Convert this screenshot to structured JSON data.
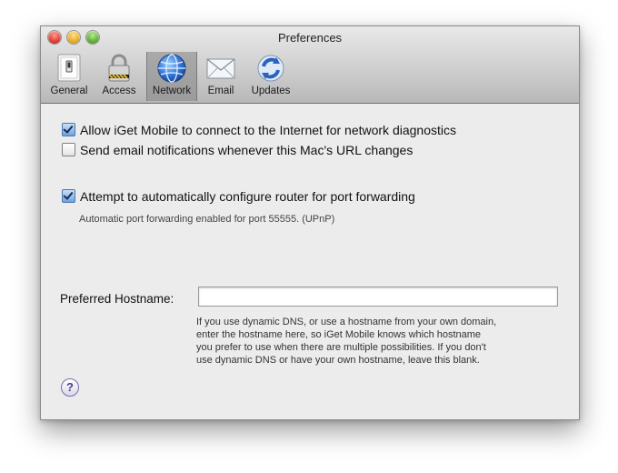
{
  "window": {
    "title": "Preferences"
  },
  "toolbar": {
    "items": [
      {
        "label": "General",
        "icon": "switch-icon"
      },
      {
        "label": "Access",
        "icon": "lock-icon"
      },
      {
        "label": "Network",
        "icon": "globe-icon",
        "selected": true
      },
      {
        "label": "Email",
        "icon": "envelope-icon"
      },
      {
        "label": "Updates",
        "icon": "sync-icon"
      }
    ]
  },
  "options": {
    "allow_connect": {
      "label": "Allow iGet Mobile to connect to the Internet for network diagnostics",
      "checked": true
    },
    "email_notify": {
      "label": "Send email notifications whenever this Mac's URL changes",
      "checked": false
    },
    "auto_router": {
      "label": "Attempt to automatically configure router for port forwarding",
      "checked": true
    },
    "port_status": "Automatic port forwarding enabled for port 55555. (UPnP)"
  },
  "hostname": {
    "label": "Preferred Hostname:",
    "value": "",
    "help": [
      "If you use dynamic DNS, or use a hostname from your own domain,",
      "enter the hostname here, so iGet Mobile knows which hostname",
      "you prefer to use when there are multiple possibilities. If you don't",
      "use dynamic DNS or have your own hostname, leave this blank."
    ]
  },
  "help_button": {
    "label": "?"
  },
  "colors": {
    "accent": "#2f6fd0",
    "help_button_border": "#7c6bb0"
  }
}
